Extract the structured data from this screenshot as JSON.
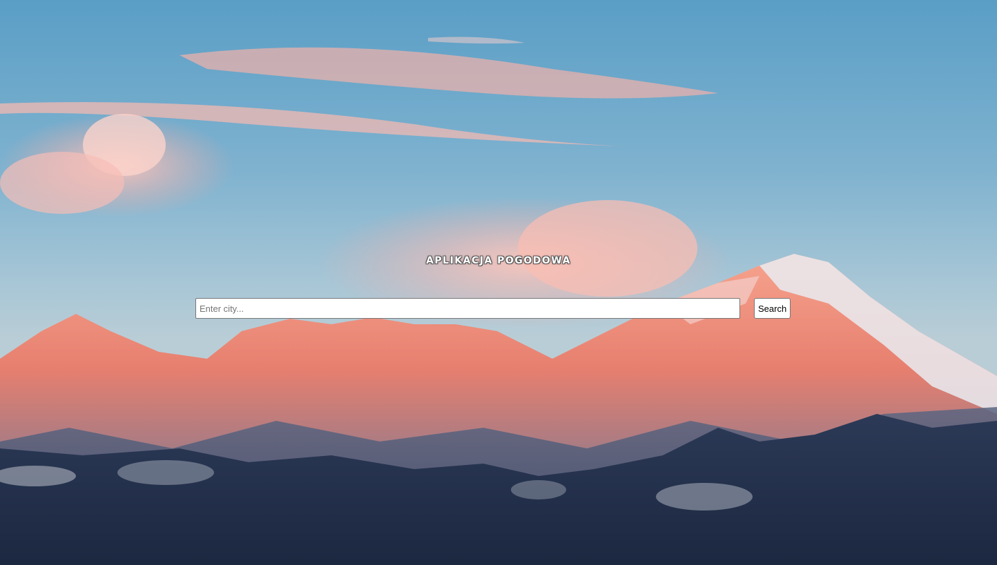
{
  "app": {
    "title": "APLIKACJA POGODOWA"
  },
  "search": {
    "placeholder": "Enter city...",
    "value": "",
    "button_label": "Search"
  },
  "background": {
    "description_icon": "mountain-landscape-image",
    "sky_color": "#5a9ec6",
    "cloud_color": "#f6b3ae",
    "peak_color": "#f08a72",
    "foreground_color": "#24334d"
  }
}
